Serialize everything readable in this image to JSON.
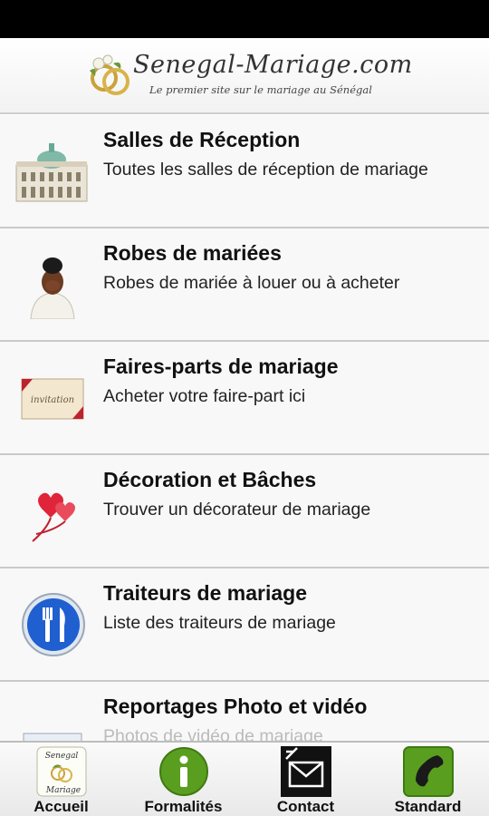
{
  "header": {
    "logo_title": "Senegal-Mariage.com",
    "logo_tagline": "Le premier site sur le mariage au Sénégal"
  },
  "menu": {
    "items": [
      {
        "title": "Salles de Réception",
        "description": "Toutes les salles de réception de mariage",
        "icon": "reception-hall-icon"
      },
      {
        "title": "Robes de mariées",
        "description": "Robes de mariée à louer ou à acheter",
        "icon": "bride-icon"
      },
      {
        "title": "Faires-parts de mariage",
        "description": "Acheter votre faire-part ici",
        "icon": "invitation-card-icon",
        "icon_text": "invitation"
      },
      {
        "title": "Décoration et Bâches",
        "description": "Trouver un décorateur de mariage",
        "icon": "heart-balloons-icon"
      },
      {
        "title": "Traiteurs de mariage",
        "description": "Liste des traiteurs de mariage",
        "icon": "fork-knife-icon"
      },
      {
        "title": "Reportages Photo et vidéo",
        "description": "Photos de vidéo de mariage",
        "icon": "photo-icon"
      }
    ]
  },
  "tabbar": {
    "tabs": [
      {
        "label": "Accueil",
        "icon": "home-logo-icon",
        "icon_text_top": "Senegal",
        "icon_text_bottom": "Mariage"
      },
      {
        "label": "Formalités",
        "icon": "info-icon"
      },
      {
        "label": "Contact",
        "icon": "mail-icon"
      },
      {
        "label": "Standard",
        "icon": "phone-icon"
      }
    ]
  },
  "colors": {
    "accent_green": "#5a9e1f",
    "fork_blue": "#1f5fd0",
    "heart_red": "#e0243a"
  }
}
